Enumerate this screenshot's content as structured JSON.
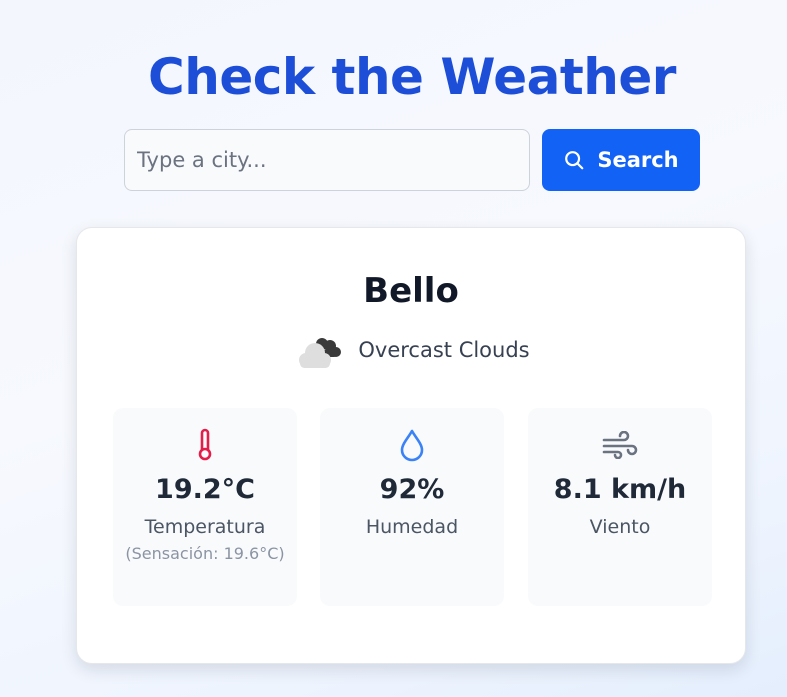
{
  "header": {
    "title": "Check the Weather"
  },
  "search": {
    "placeholder": "Type a city...",
    "value": "",
    "button_label": "Search",
    "button_icon": "search-icon"
  },
  "weather": {
    "city": "Bello",
    "condition": "Overcast Clouds",
    "condition_icon": "overcast-clouds-icon",
    "stats": [
      {
        "icon": "thermometer-icon",
        "value": "19.2°C",
        "label": "Temperatura",
        "sub": "(Sensación: 19.6°C)"
      },
      {
        "icon": "droplet-icon",
        "value": "92%",
        "label": "Humedad"
      },
      {
        "icon": "wind-icon",
        "value": "8.1 km/h",
        "label": "Viento"
      }
    ]
  },
  "colors": {
    "title": "#1d4ed8",
    "button": "#1262f6",
    "thermometer": "#e11d48",
    "droplet": "#3b82f6",
    "wind": "#6b7280"
  }
}
